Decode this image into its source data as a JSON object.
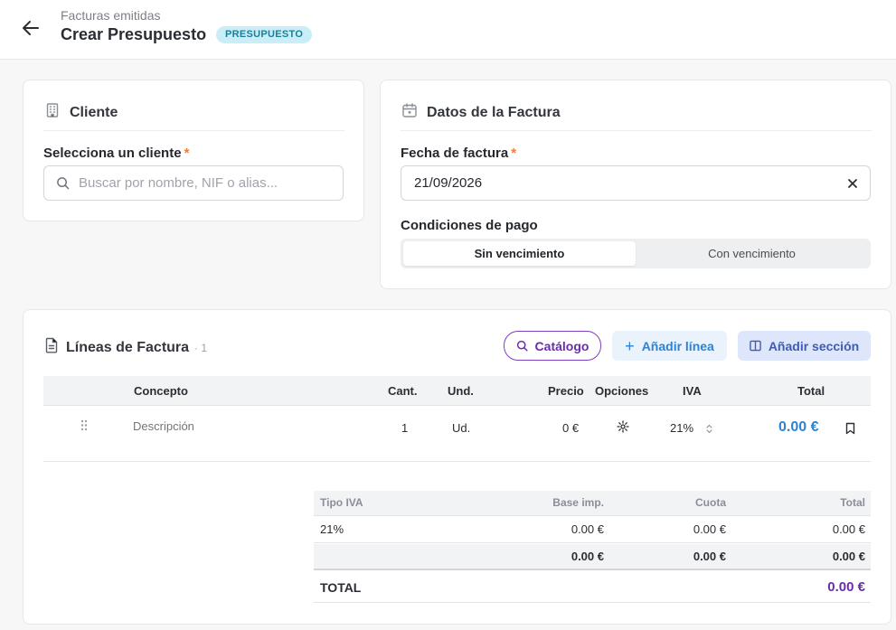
{
  "header": {
    "breadcrumb": "Facturas emitidas",
    "title": "Crear Presupuesto",
    "badge": "PRESUPUESTO"
  },
  "client_card": {
    "title": "Cliente",
    "field_label": "Selecciona un cliente",
    "required_mark": "*",
    "search_placeholder": "Buscar por nombre, NIF o alias..."
  },
  "invoice_card": {
    "title": "Datos de la Factura",
    "date_label": "Fecha de factura",
    "required_mark": "*",
    "date_value": "21/09/2026",
    "payment_label": "Condiciones de pago",
    "payment_options": [
      "Sin vencimiento",
      "Con vencimiento"
    ],
    "payment_selected": "Sin vencimiento"
  },
  "lines_card": {
    "title": "Líneas de Factura",
    "count": "· 1",
    "catalog_button": "Catálogo",
    "add_line_button": "Añadir línea",
    "add_section_button": "Añadir sección",
    "columns": {
      "concept": "Concepto",
      "qty": "Cant.",
      "unit": "Und.",
      "price": "Precio",
      "options": "Opciones",
      "vat": "IVA",
      "total": "Total"
    },
    "row": {
      "description_placeholder": "Descripción",
      "qty": "1",
      "unit": "Ud.",
      "price": "0 €",
      "vat": "21%",
      "total": "0.00 €"
    }
  },
  "vat_summary": {
    "columns": {
      "type": "Tipo IVA",
      "base": "Base imp.",
      "quota": "Cuota",
      "total": "Total"
    },
    "rows": [
      {
        "type": "21%",
        "base": "0.00 €",
        "quota": "0.00 €",
        "total": "0.00 €"
      }
    ],
    "subtotal": {
      "base": "0.00 €",
      "quota": "0.00 €",
      "total": "0.00 €"
    },
    "grand_total_label": "TOTAL",
    "grand_total_value": "0.00 €"
  },
  "colors": {
    "accent_purple": "#6a2bb0",
    "accent_blue": "#2c82d4",
    "badge_bg": "#c9eef7",
    "required": "#f07c3f"
  }
}
